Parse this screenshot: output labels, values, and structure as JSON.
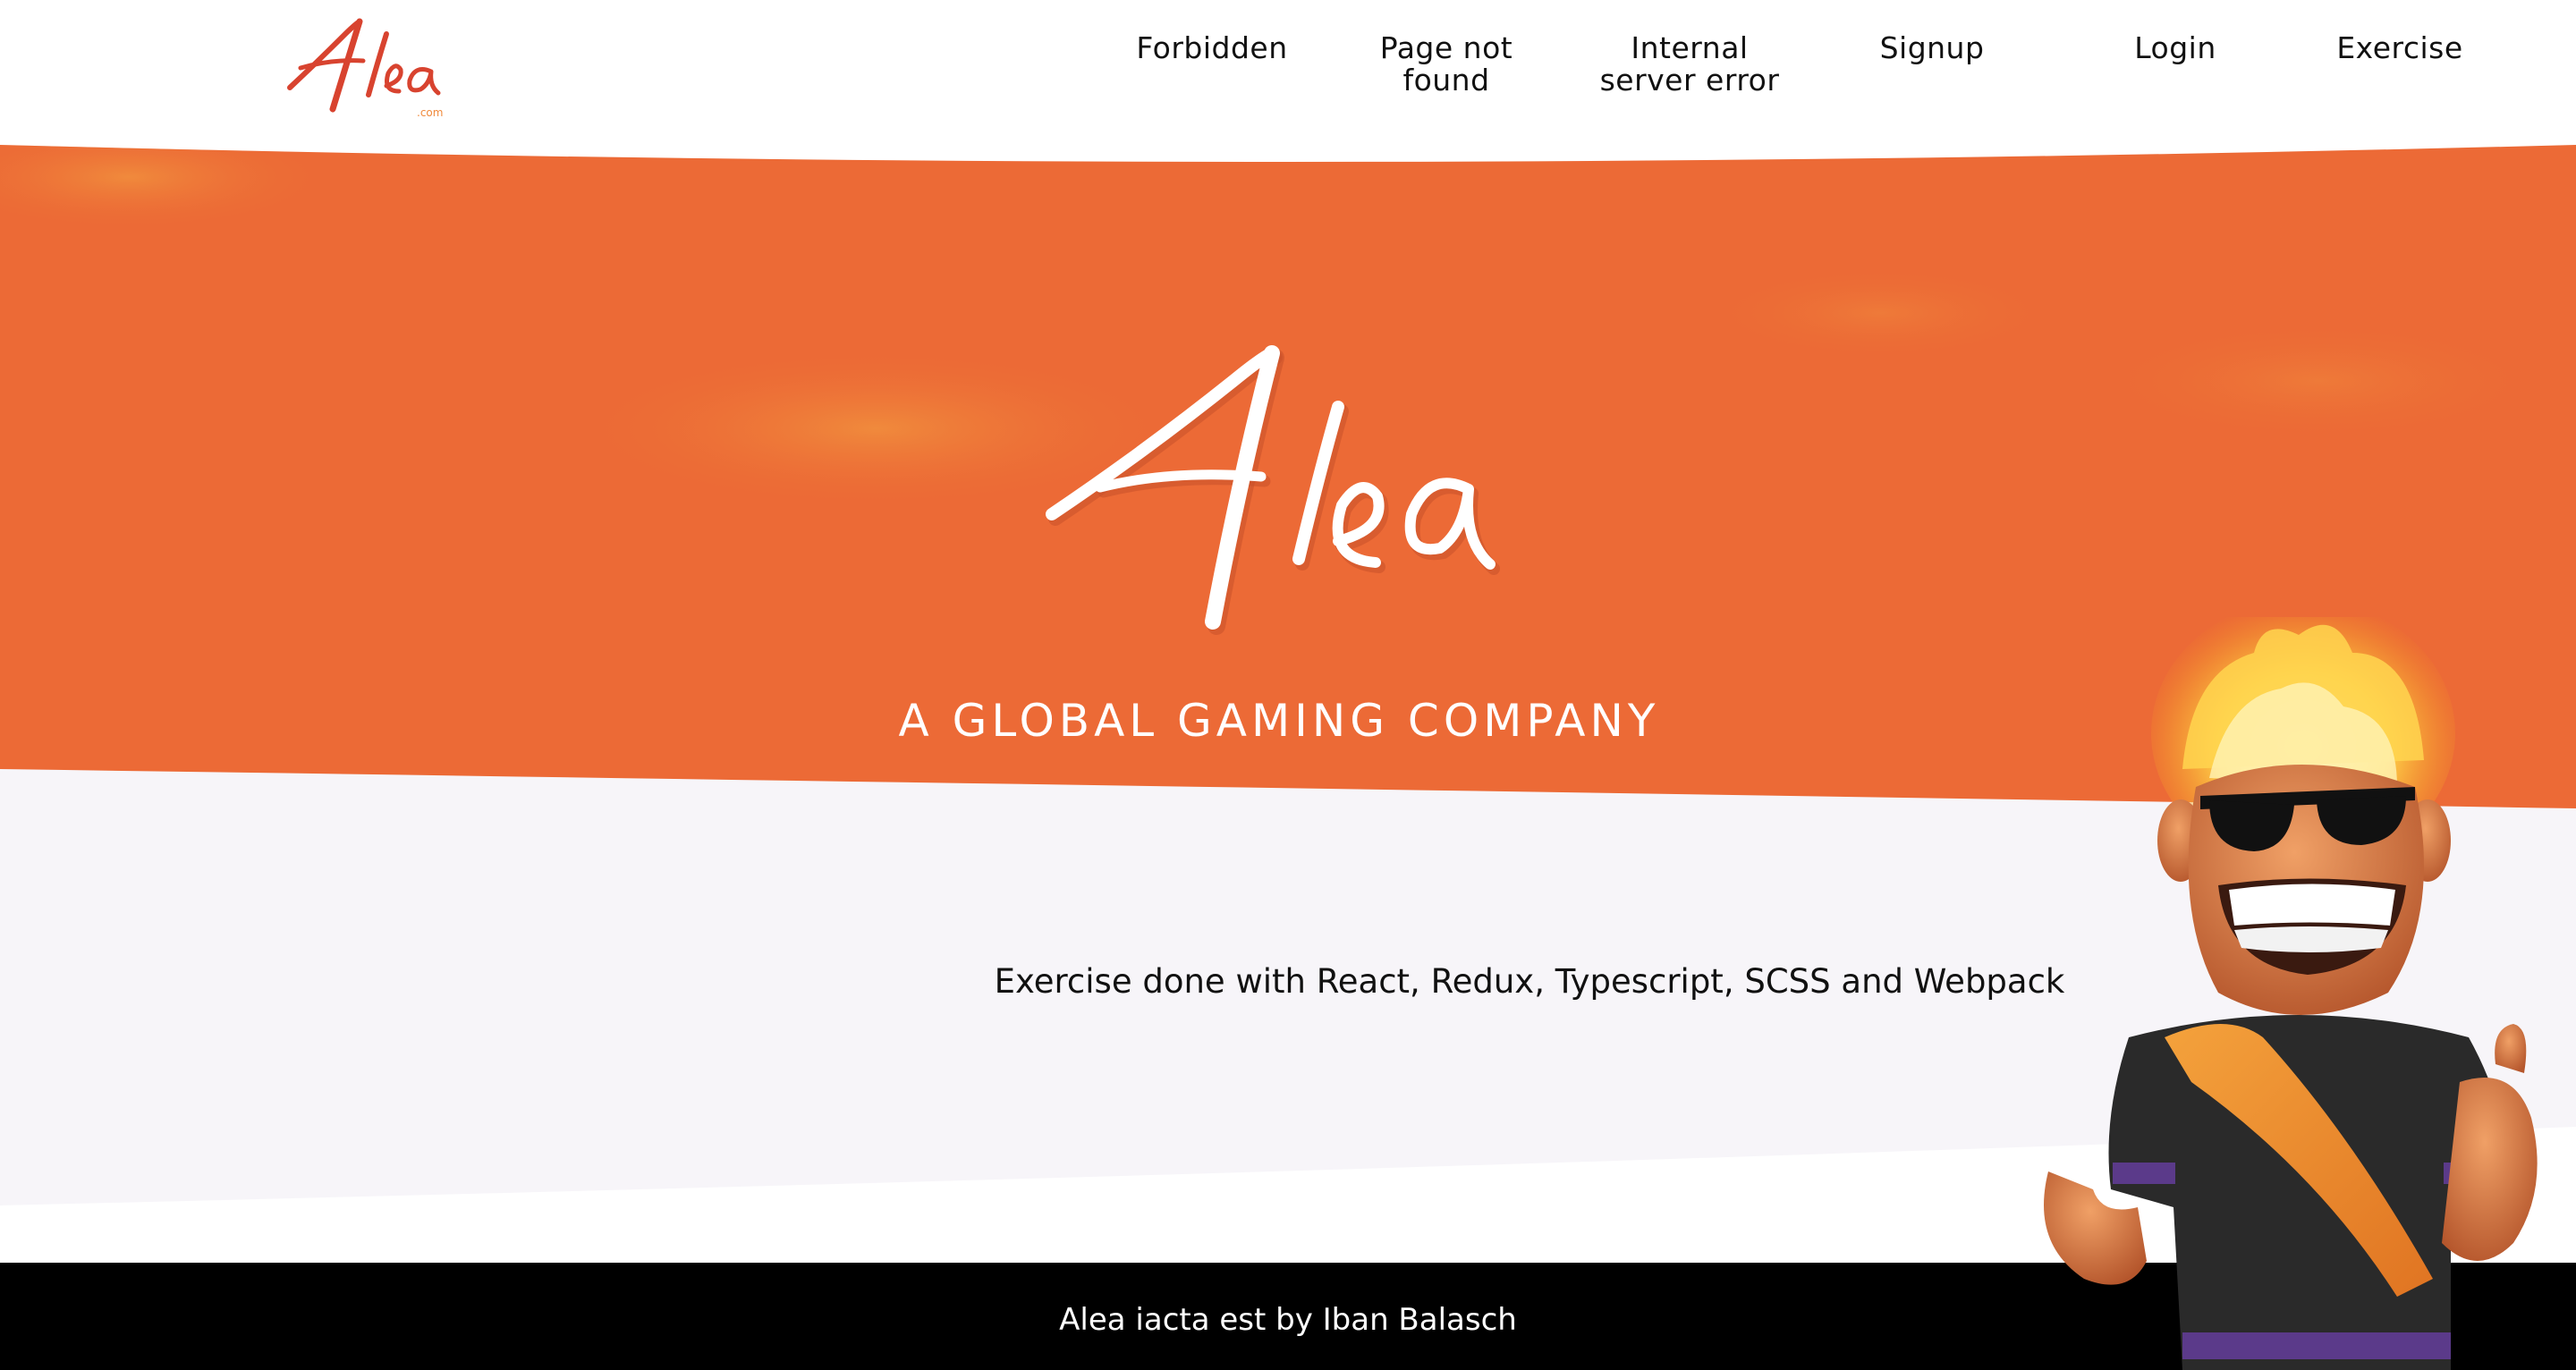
{
  "header": {
    "logo_icon": "alea-logo-icon",
    "logo_alt": "Alea .com",
    "nav": [
      {
        "label": "Forbidden"
      },
      {
        "label": "Page not found"
      },
      {
        "label": "Internal server error"
      },
      {
        "label": "Signup"
      },
      {
        "label": "Login"
      },
      {
        "label": "Exercise"
      }
    ]
  },
  "hero": {
    "logo_icon": "alea-logo-icon",
    "tagline": "A GLOBAL GAMING COMPANY"
  },
  "main": {
    "description": "Exercise done with React, Redux, Typescript, SCSS and Webpack"
  },
  "mascot": {
    "icon": "mascot-character-icon"
  },
  "footer": {
    "text": "Alea iacta est by Iban Balasch"
  },
  "colors": {
    "accent": "#EC6A35",
    "accent_light": "#F08A3C",
    "background_light": "#F7F5F9",
    "footer_bg": "#000000",
    "text_dark": "#111111",
    "logo_red": "#D8432F"
  }
}
